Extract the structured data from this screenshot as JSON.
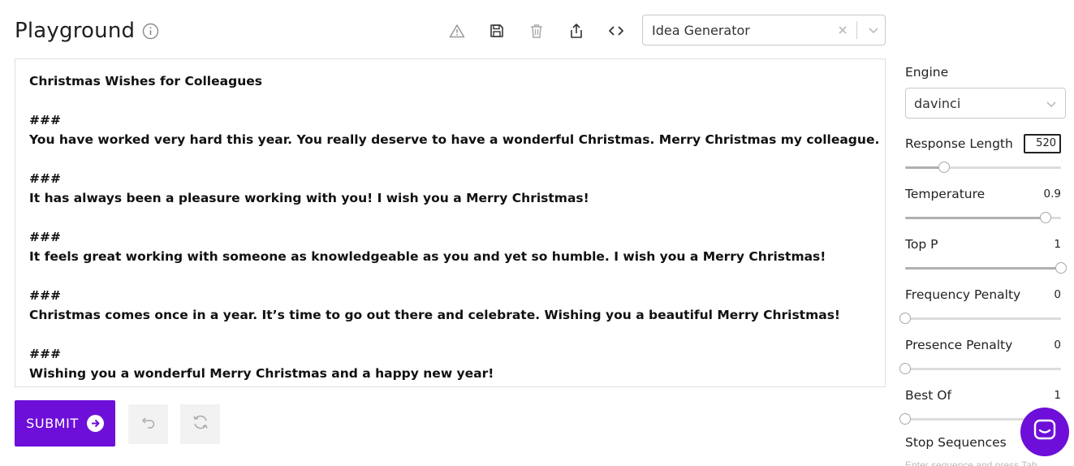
{
  "header": {
    "title": "Playground"
  },
  "toolbar": {
    "icons": [
      "warning-icon",
      "save-icon",
      "trash-icon",
      "share-icon",
      "code-icon"
    ]
  },
  "preset": {
    "value": "Idea Generator"
  },
  "editor": {
    "lines": [
      "Christmas Wishes for Colleagues",
      "",
      "###",
      "You have worked very hard this year. You really deserve to have a wonderful Christmas. Merry Christmas my colleague.",
      "",
      "###",
      "It has always been a pleasure working with you! I wish you a Merry Christmas!",
      "",
      "###",
      "It feels great working with someone as knowledgeable as you and yet so humble. I wish you a Merry Christmas!",
      "",
      "###",
      "Christmas comes once in a year. It’s time to go out there and celebrate. Wishing you a beautiful Merry Christmas!",
      "",
      "###",
      "Wishing you a wonderful Merry Christmas and a happy new year!"
    ]
  },
  "actions": {
    "submit_label": "SUBMIT"
  },
  "sidebar": {
    "engine_label": "Engine",
    "engine_value": "davinci",
    "params": [
      {
        "label": "Response Length",
        "value": "520",
        "level": 0.25
      },
      {
        "label": "Temperature",
        "value": "0.9",
        "level": 0.9
      },
      {
        "label": "Top P",
        "value": "1",
        "level": 1.0
      },
      {
        "label": "Frequency Penalty",
        "value": "0",
        "level": 0.0
      },
      {
        "label": "Presence Penalty",
        "value": "0",
        "level": 0.0
      },
      {
        "label": "Best Of",
        "value": "1",
        "level": 0.0
      }
    ],
    "stop_label": "Stop Sequences",
    "stop_hint": "Enter sequence and press Tab"
  },
  "colors": {
    "accent": "#6d0fd8",
    "border": "#dedede",
    "track": "#dcdcdc"
  }
}
